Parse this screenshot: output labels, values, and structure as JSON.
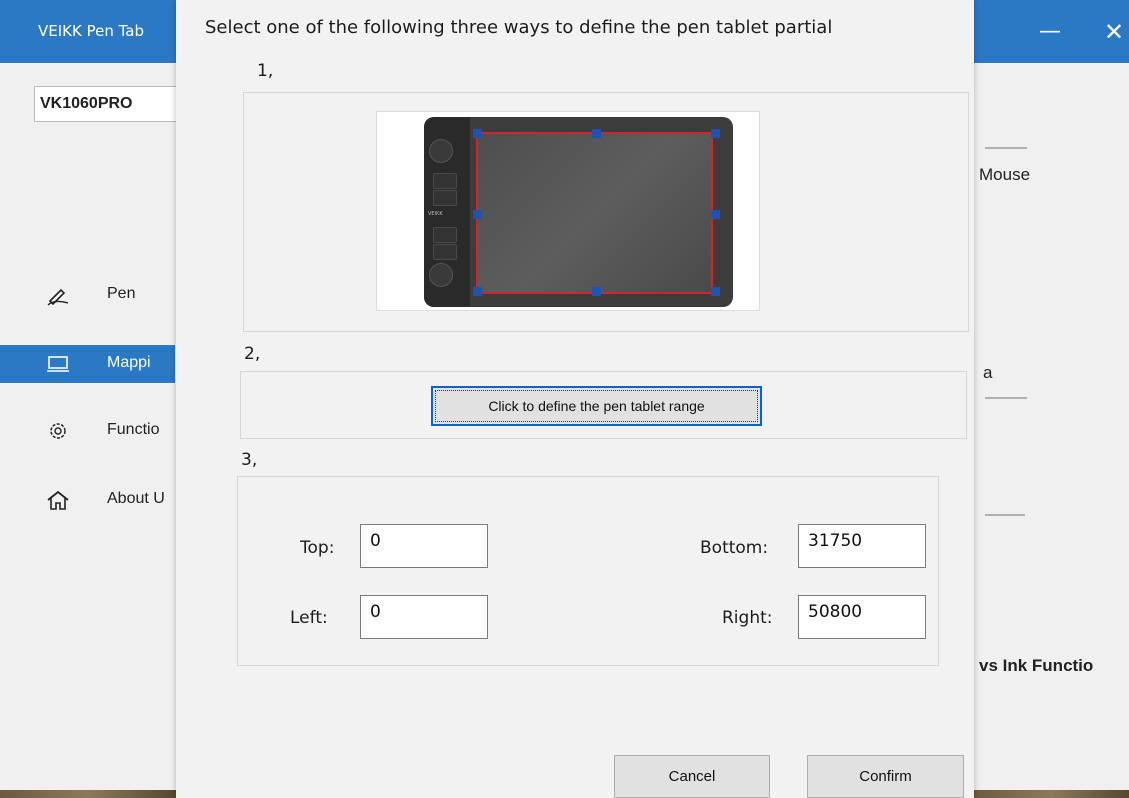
{
  "app": {
    "title": "VEIKK Pen Tab",
    "device_select_value": "VK1060PRO",
    "accent_color": "#2b78c4",
    "nav": [
      {
        "label": "Pen",
        "icon": "pen-icon"
      },
      {
        "label": "Mappi",
        "icon": "monitor-icon",
        "active": true
      },
      {
        "label": "Functio",
        "icon": "gear-icon"
      },
      {
        "label": "About U",
        "icon": "home-icon"
      }
    ],
    "right_texts": {
      "mouse": "Mouse",
      "partial_char": "a",
      "ink": "vs Ink Functio"
    }
  },
  "dialog": {
    "title": "Select one of the following three ways to define the pen tablet partial",
    "section1_label": "1,",
    "section2_label": "2,",
    "section3_label": "3,",
    "tablet_brand": "VEIKK",
    "define_button": "Click to define the pen tablet range",
    "fields": {
      "top_label": "Top:",
      "top_value": "0",
      "bottom_label": "Bottom:",
      "bottom_value": "31750",
      "left_label": "Left:",
      "left_value": "0",
      "right_label": "Right:",
      "right_value": "50800"
    },
    "cancel": "Cancel",
    "confirm": "Confirm",
    "range_color": "#d0262b",
    "handle_color": "#1f52b5"
  }
}
